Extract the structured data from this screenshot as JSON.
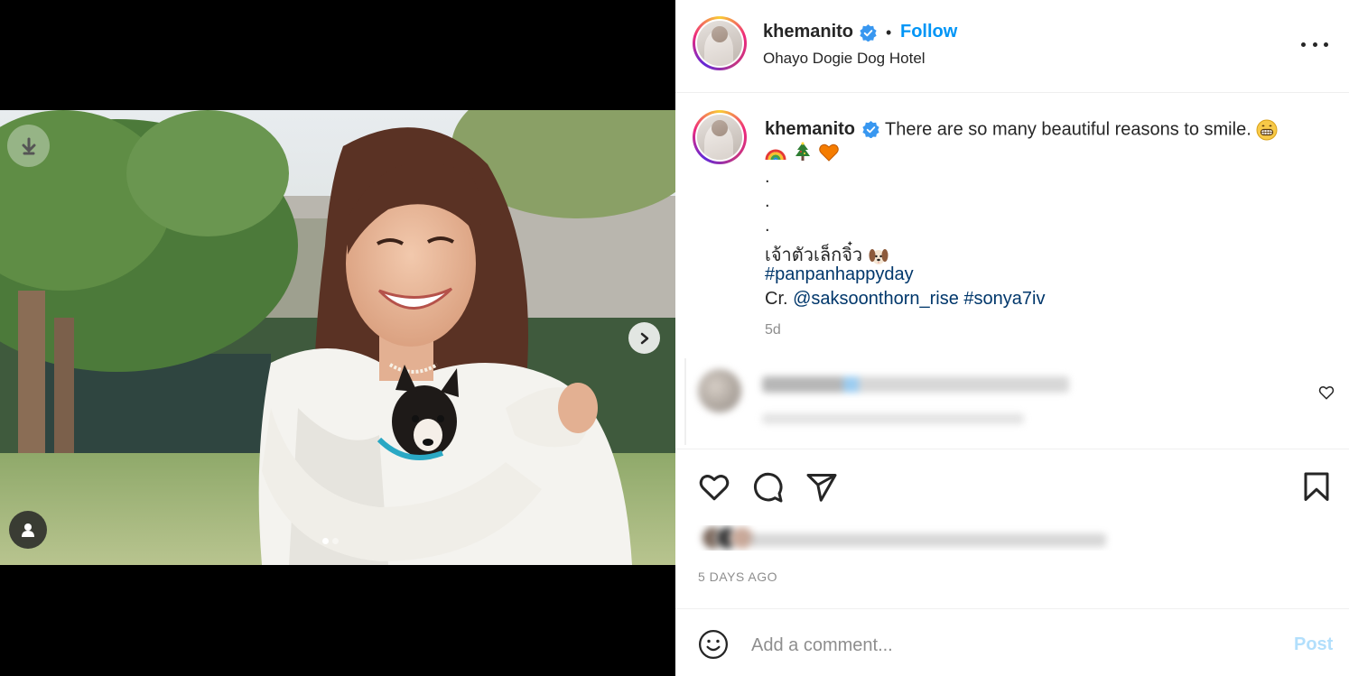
{
  "media": {
    "download_icon": "download-arrow-icon",
    "next_icon": "chevron-right-icon",
    "tag_icon": "user-tag-icon",
    "carousel_total": 2,
    "carousel_active": 1
  },
  "header": {
    "username": "khemanito",
    "verified": true,
    "separator": "•",
    "follow_label": "Follow",
    "location": "Ohayo Dogie Dog Hotel",
    "more_icon": "more-options-icon"
  },
  "caption": {
    "username": "khemanito",
    "text": "There are so many beautiful reasons to smile.",
    "emoji_after_text": "grinning-face",
    "emoji_line": [
      "rainbow",
      "christmas-tree",
      "orange-heart"
    ],
    "dot_lines": [
      ".",
      ".",
      "."
    ],
    "thai_line": "เจ้าตัวเล็กจิ๋ว",
    "thai_emoji": "dog-face",
    "hashtag_line": "#panpanhappyday",
    "credit_prefix": "Cr.",
    "credit_mention": "@saksoonthorn_rise",
    "credit_hashtag": "#sonya7iv",
    "time_ago": "5d"
  },
  "actions": {
    "like_icon": "heart-icon",
    "comment_icon": "comment-icon",
    "share_icon": "share-icon",
    "save_icon": "bookmark-icon",
    "date": "5 DAYS AGO"
  },
  "add_comment": {
    "emoji_icon": "smiley-icon",
    "placeholder": "Add a comment...",
    "post_label": "Post"
  },
  "colors": {
    "link": "#00376b",
    "follow": "#0095f6",
    "verified": "#3897f0",
    "muted": "#8e8e8e",
    "post_disabled": "#b2dffc"
  }
}
